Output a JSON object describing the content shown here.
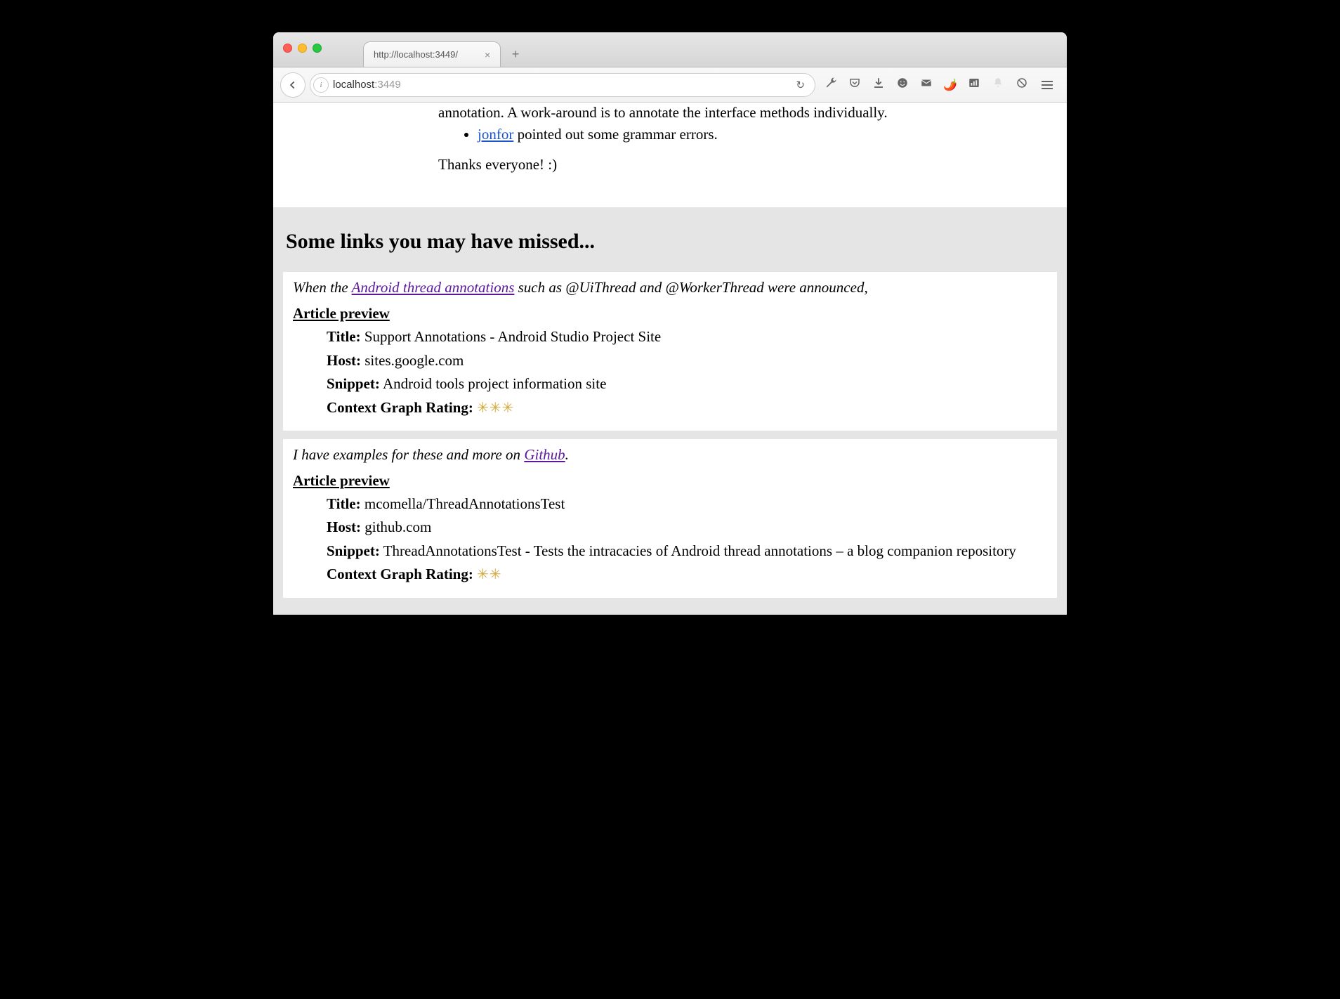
{
  "window": {
    "tab_title": "http://localhost:3449/",
    "url_host": "localhost",
    "url_port": ":3449"
  },
  "content": {
    "li1_prefix": "annotation. A work-around is to annotate the interface methods individually.",
    "li2_link": "jonfor",
    "li2_suffix": " pointed out some grammar errors.",
    "thanks": "Thanks everyone! :)"
  },
  "section": {
    "heading": "Some links you may have missed...",
    "preview_label": "Article preview",
    "title_label": "Title:",
    "host_label": "Host:",
    "snippet_label": "Snippet:",
    "rating_label": "Context Graph Rating:",
    "cards": [
      {
        "quote_pre": "When the ",
        "quote_link": "Android thread annotations",
        "quote_post": " such as @UiThread and @WorkerThread were announced,",
        "title": "Support Annotations - Android Studio Project Site",
        "host": "sites.google.com",
        "snippet": "Android tools project information site",
        "stars": "✳✳✳"
      },
      {
        "quote_pre": "I have examples for these and more on ",
        "quote_link": "Github",
        "quote_post": ".",
        "title": "mcomella/ThreadAnnotationsTest",
        "host": "github.com",
        "snippet": "ThreadAnnotationsTest - Tests the intracacies of Android thread annotations – a blog companion repository",
        "stars": "✳✳"
      }
    ]
  }
}
